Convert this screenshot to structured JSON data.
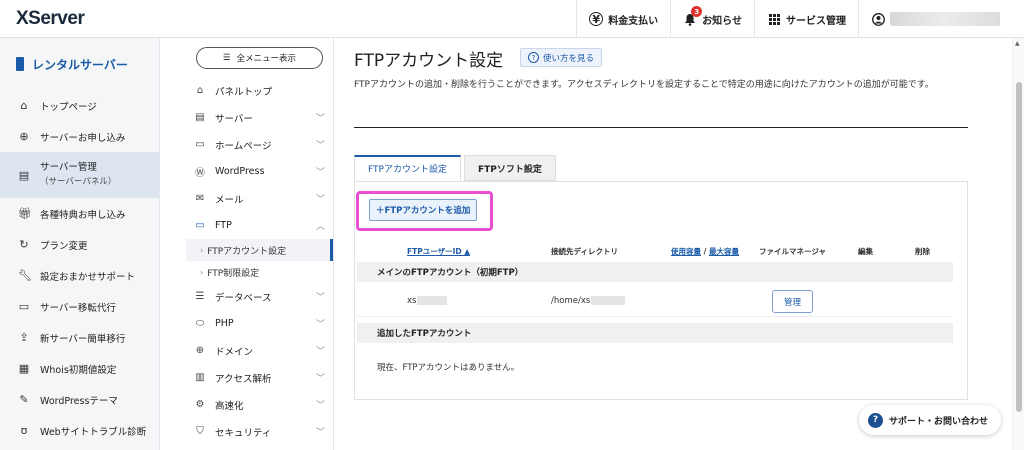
{
  "header": {
    "logo": "XServer",
    "payment": "料金支払い",
    "notifications": "お知らせ",
    "notification_count": "3",
    "service_management": "サービス管理"
  },
  "sidebar": {
    "title": "レンタルサーバー",
    "items": [
      {
        "label": "トップページ",
        "icon": "home-icon"
      },
      {
        "label": "サーバーお申し込み",
        "icon": "plus-circle-icon"
      },
      {
        "label": "サーバー管理",
        "sub": "（サーバーパネル）",
        "icon": "server-icon"
      },
      {
        "label": "各種特典お申し込み",
        "icon": "gift-icon"
      },
      {
        "label": "プラン変更",
        "icon": "refresh-icon"
      },
      {
        "label": "設定おまかせサポート",
        "icon": "wrench-icon"
      },
      {
        "label": "サーバー移転代行",
        "icon": "truck-icon"
      },
      {
        "label": "新サーバー簡単移行",
        "icon": "upload-icon"
      },
      {
        "label": "Whois初期値設定",
        "icon": "document-icon"
      },
      {
        "label": "WordPressテーマ",
        "icon": "edit-icon"
      },
      {
        "label": "Webサイトトラブル診断",
        "icon": "stethoscope-icon"
      }
    ]
  },
  "menu": {
    "all_menu": "全メニュー表示",
    "items": [
      {
        "label": "パネルトップ",
        "icon": "home-icon"
      },
      {
        "label": "サーバー",
        "icon": "server-icon"
      },
      {
        "label": "ホームページ",
        "icon": "window-icon"
      },
      {
        "label": "WordPress",
        "icon": "wordpress-icon"
      },
      {
        "label": "メール",
        "icon": "mail-icon"
      },
      {
        "label": "FTP",
        "icon": "monitor-icon"
      }
    ],
    "ftp_sub": [
      "FTPアカウント設定",
      "FTP制限設定"
    ],
    "items2": [
      {
        "label": "データベース",
        "icon": "database-icon"
      },
      {
        "label": "PHP",
        "icon": "php-icon"
      },
      {
        "label": "ドメイン",
        "icon": "globe-icon"
      },
      {
        "label": "アクセス解析",
        "icon": "chart-icon"
      },
      {
        "label": "高速化",
        "icon": "speed-icon"
      },
      {
        "label": "セキュリティ",
        "icon": "shield-icon"
      }
    ]
  },
  "main": {
    "title": "FTPアカウント設定",
    "help": "使い方を見る",
    "description": "FTPアカウントの追加・削除を行うことができます。アクセスディレクトリを設定することで特定の用途に向けたアカウントの追加が可能です。",
    "tabs": [
      "FTPアカウント設定",
      "FTPソフト設定"
    ],
    "add_button": "＋FTPアカウントを追加",
    "columns": {
      "user_id": "FTPユーザーID ▲",
      "directory": "接続先ディレクトリ",
      "usage": "使用容量",
      "sep": " / ",
      "max": "最大容量",
      "file_manager": "ファイルマネージャ",
      "edit": "編集",
      "delete": "削除"
    },
    "section_main": "メインのFTPアカウント（初期FTP）",
    "row": {
      "user": "xs",
      "dir": "/home/xs",
      "manage": "管理"
    },
    "section_added": "追加したFTPアカウント",
    "empty": "現在、FTPアカウントはありません。"
  },
  "support": "サポート・お問い合わせ"
}
